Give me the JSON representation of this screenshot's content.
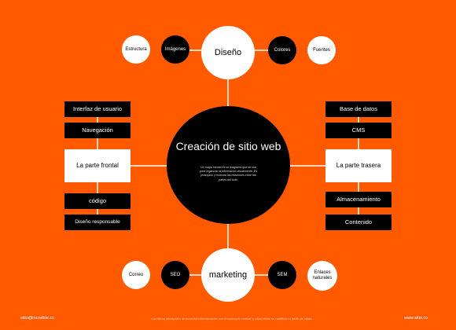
{
  "center": {
    "title": "Creación de sitio web",
    "description": "Un mapa mental es un diagrama que se usa para organizar la información visualmente. Es jerárquico y muestra las relaciones entre las partes del todo."
  },
  "top": {
    "hub": "Diseño",
    "items": [
      "Estructura",
      "Imágenes",
      "Colores",
      "Fuentes"
    ]
  },
  "bottom": {
    "hub": "marketing",
    "items": [
      "Correo",
      "SEO",
      "SEM",
      "Enlaces naturales"
    ]
  },
  "left": {
    "hub": "La parte frontal",
    "items": [
      "Interfaz de usuario",
      "Navegación",
      "código",
      "Diseño responsable"
    ]
  },
  "right": {
    "hub": "La parte trasera",
    "items": [
      "Base de datos",
      "CMS",
      "Almacenamiento",
      "Contenido"
    ]
  },
  "footer": {
    "email": "sitio@increible.co",
    "note": "Las ideas principales se conectan directamente con el concepto central, y otras ideas se ramifican a partir de estas.",
    "website": "www.sitio.co"
  },
  "colors": {
    "background": "#ff5a00",
    "node_dark": "#000000",
    "node_light": "#ffffff"
  }
}
